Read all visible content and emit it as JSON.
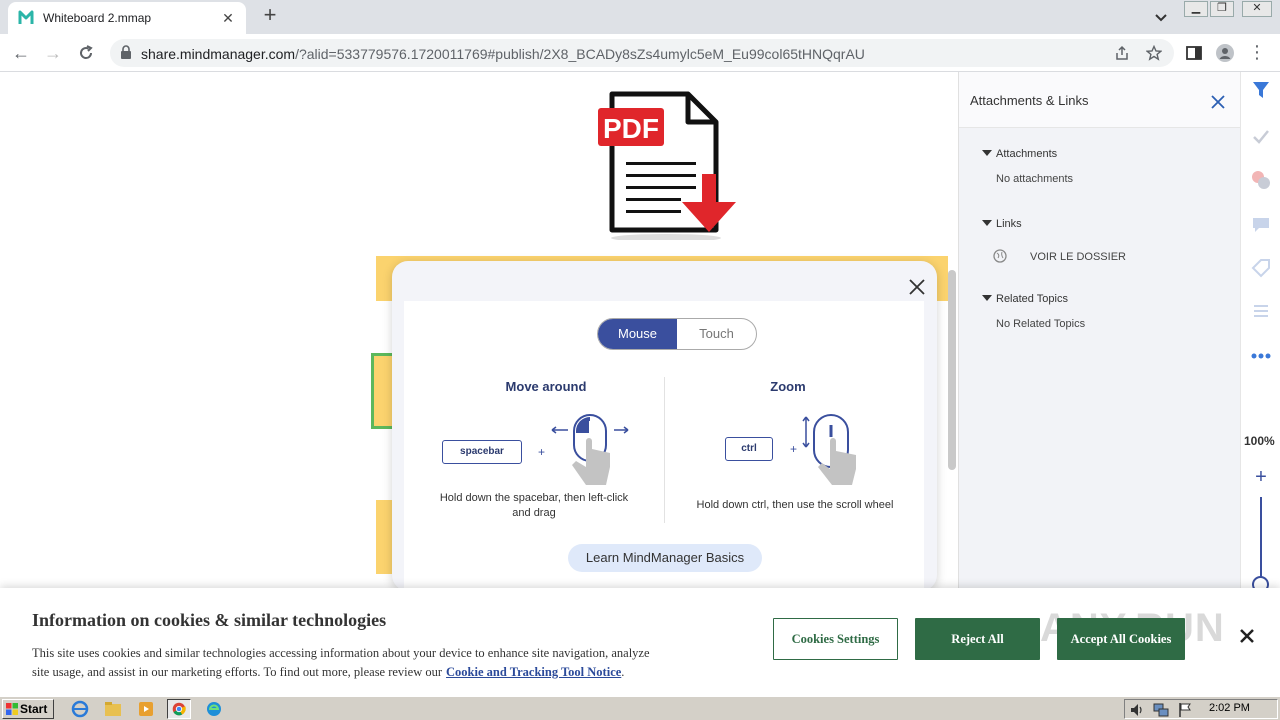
{
  "browser": {
    "tab_title": "Whiteboard 2.mmap",
    "url_host": "share.mindmanager.com",
    "url_path": "/?alid=533779576.1720011769#publish/2X8_BCADy8sZs4umylc5eM_Eu99col65tHNQqrAU"
  },
  "help_dialog": {
    "mode_tabs": [
      "Mouse",
      "Touch"
    ],
    "active_mode": "Mouse",
    "move": {
      "title": "Move around",
      "key": "spacebar",
      "plus": "+",
      "caption_line1": "Hold down the spacebar, then left-click",
      "caption_line2": "and drag"
    },
    "zoom": {
      "title": "Zoom",
      "key": "ctrl",
      "plus": "+",
      "caption": "Hold down ctrl, then use the scroll wheel"
    },
    "learn_button": "Learn MindManager Basics"
  },
  "panel": {
    "title": "Attachments & Links",
    "attachments_header": "Attachments",
    "attachments_empty": "No attachments",
    "links_header": "Links",
    "link_item": "VOIR LE DOSSIER",
    "related_header": "Related Topics",
    "related_empty": "No Related Topics"
  },
  "rail": {
    "zoom_level": "100%"
  },
  "cookie": {
    "title": "Information on cookies & similar technologies",
    "body_line1": "This site uses cookies and similar technologies accessing information about your device to enhance site navigation, analyze",
    "body_line2": "site usage, and assist in our marketing efforts. To find out more, please review our",
    "link": "Cookie and Tracking Tool Notice",
    "period": ".",
    "settings_button": "Cookies Settings",
    "reject_button": "Reject All",
    "accept_button": "Accept All Cookies"
  },
  "watermark": "ANY.RUN",
  "taskbar": {
    "start_label": "Start",
    "clock": "2:02 PM"
  },
  "colors": {
    "brand_blue": "#3a4f9e",
    "cookie_green": "#2f6b45",
    "topic_yellow": "#fbd36e",
    "pdf_red": "#e0262b"
  }
}
